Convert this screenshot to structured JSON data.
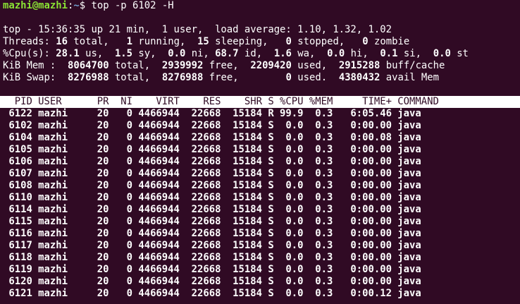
{
  "prompt": {
    "user_host": "mazhi@mazhi",
    "colon": ":",
    "path": "~",
    "dollar": "$",
    "command": " top -p 6102 -H"
  },
  "summary": {
    "line1": "top - 15:36:35 up 21 min,  1 user,  load average: 1.10, 1.32, 1.02",
    "threads": {
      "label": "Threads:",
      "total": "16",
      "total_label": "total,",
      "running": "1",
      "running_label": "running,",
      "sleeping": "15",
      "sleeping_label": "sleeping,",
      "stopped": "0",
      "stopped_label": "stopped,",
      "zombie": "0",
      "zombie_label": "zombie"
    },
    "cpu": {
      "label": "%Cpu(s):",
      "us": "28.1",
      "us_label": "us,",
      "sy": "1.5",
      "sy_label": "sy,",
      "ni": "0.0",
      "ni_label": "ni,",
      "id": "68.7",
      "id_label": "id,",
      "wa": "1.6",
      "wa_label": "wa,",
      "hi": "0.0",
      "hi_label": "hi,",
      "si": "0.1",
      "si_label": "si,",
      "st": "0.0",
      "st_label": "st"
    },
    "mem": {
      "label": "KiB Mem :",
      "total": "8064700",
      "total_label": "total,",
      "free": "2939992",
      "free_label": "free,",
      "used": "2209420",
      "used_label": "used,",
      "buff": "2915288",
      "buff_label": "buff/cache"
    },
    "swap": {
      "label": "KiB Swap:",
      "total": "8276988",
      "total_label": "total,",
      "free": "8276988",
      "free_label": "free,",
      "used": "0",
      "used_label": "used.",
      "avail": "4380432",
      "avail_label": "avail Mem"
    }
  },
  "table": {
    "header": "  PID USER      PR  NI    VIRT    RES    SHR S %CPU %MEM     TIME+ COMMAND",
    "rows": [
      " 6122 mazhi     20   0 4466944  22668  15184 R 99.9  0.3   6:05.46 java",
      " 6102 mazhi     20   0 4466944  22668  15184 S  0.0  0.3   0:00.00 java",
      " 6104 mazhi     20   0 4466944  22668  15184 S  0.0  0.3   0:00.08 java",
      " 6105 mazhi     20   0 4466944  22668  15184 S  0.0  0.3   0:00.00 java",
      " 6106 mazhi     20   0 4466944  22668  15184 S  0.0  0.3   0:00.00 java",
      " 6107 mazhi     20   0 4466944  22668  15184 S  0.0  0.3   0:00.00 java",
      " 6108 mazhi     20   0 4466944  22668  15184 S  0.0  0.3   0:00.00 java",
      " 6110 mazhi     20   0 4466944  22668  15184 S  0.0  0.3   0:00.00 java",
      " 6114 mazhi     20   0 4466944  22668  15184 S  0.0  0.3   0:00.00 java",
      " 6115 mazhi     20   0 4466944  22668  15184 S  0.0  0.3   0:00.00 java",
      " 6116 mazhi     20   0 4466944  22668  15184 S  0.0  0.3   0:00.00 java",
      " 6117 mazhi     20   0 4466944  22668  15184 S  0.0  0.3   0:00.00 java",
      " 6118 mazhi     20   0 4466944  22668  15184 S  0.0  0.3   0:00.00 java",
      " 6119 mazhi     20   0 4466944  22668  15184 S  0.0  0.3   0:00.00 java",
      " 6120 mazhi     20   0 4466944  22668  15184 S  0.0  0.3   0:00.00 java",
      " 6121 mazhi     20   0 4466944  22668  15184 S  0.0  0.3   0:00.12 java"
    ]
  },
  "colors": {
    "background": "#300a24",
    "foreground": "#ffffff",
    "prompt_user": "#8ae234",
    "prompt_path": "#729fcf"
  }
}
